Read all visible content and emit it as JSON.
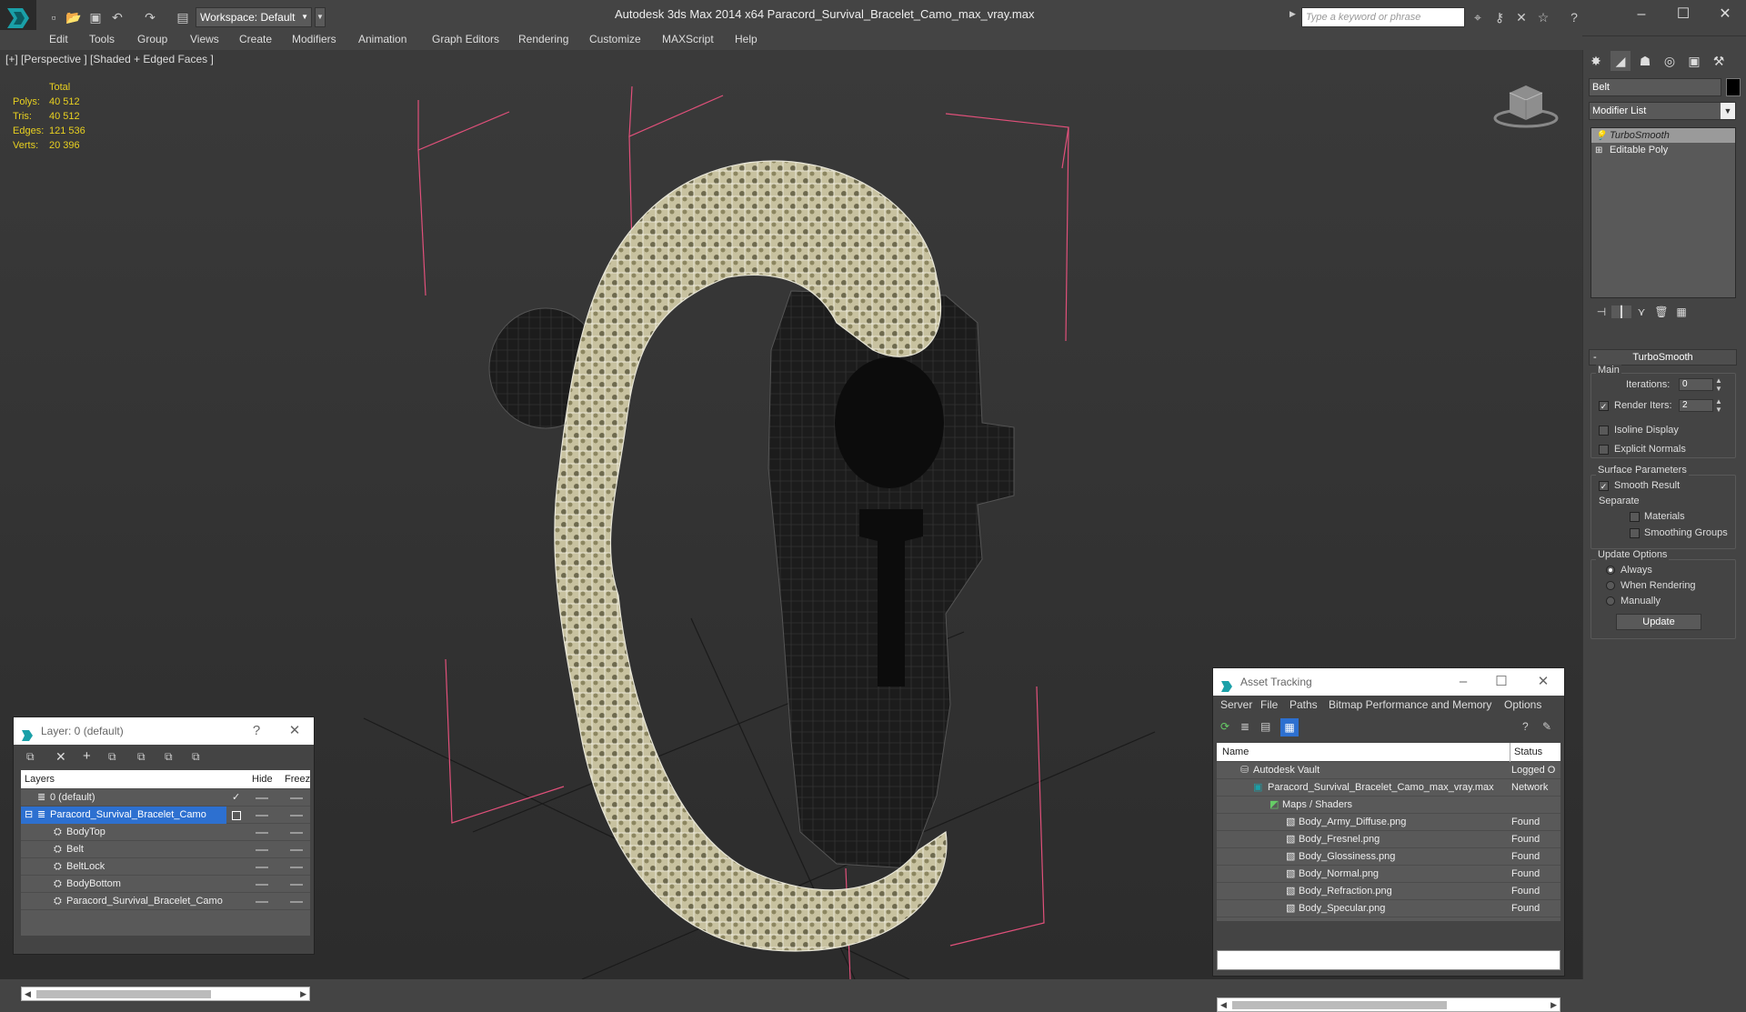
{
  "title_bar": {
    "app_title": "Autodesk 3ds Max  2014 x64      Paracord_Survival_Bracelet_Camo_max_vray.max",
    "workspace_label": "Workspace: Default",
    "search_placeholder": "Type a keyword or phrase"
  },
  "menu": [
    "Edit",
    "Tools",
    "Group",
    "Views",
    "Create",
    "Modifiers",
    "Animation",
    "Graph Editors",
    "Rendering",
    "Customize",
    "MAXScript",
    "Help"
  ],
  "viewport": {
    "label": "[+] [Perspective ] [Shaded + Edged Faces ]",
    "stats": {
      "header": "Total",
      "rows": [
        {
          "label": "Polys:",
          "value": "40 512"
        },
        {
          "label": "Tris:",
          "value": "40 512"
        },
        {
          "label": "Edges:",
          "value": "121 536"
        },
        {
          "label": "Verts:",
          "value": "20 396"
        }
      ]
    }
  },
  "command_panel": {
    "object_name": "Belt",
    "modifier_list": "Modifier List",
    "stack": [
      "TurboSmooth",
      "Editable Poly"
    ],
    "rollout_title": "TurboSmooth",
    "main_label": "Main",
    "iterations_label": "Iterations:",
    "iterations_value": "0",
    "render_iters_label": "Render Iters:",
    "render_iters_value": "2",
    "isoline_label": "Isoline Display",
    "explicit_normals_label": "Explicit Normals",
    "surface_params_label": "Surface Parameters",
    "smooth_result_label": "Smooth Result",
    "separate_label": "Separate",
    "materials_label": "Materials",
    "smoothing_groups_label": "Smoothing Groups",
    "update_options_label": "Update Options",
    "always_label": "Always",
    "when_rendering_label": "When Rendering",
    "manually_label": "Manually",
    "update_button": "Update"
  },
  "layer_panel": {
    "title": "Layer: 0 (default)",
    "help": "?",
    "columns": [
      "Layers",
      "Hide",
      "Freez"
    ],
    "rows": [
      {
        "name": "0 (default)",
        "level": 0
      },
      {
        "name": "Paracord_Survival_Bracelet_Camo",
        "level": 0
      },
      {
        "name": "BodyTop",
        "level": 1
      },
      {
        "name": "Belt",
        "level": 1
      },
      {
        "name": "BeltLock",
        "level": 1
      },
      {
        "name": "BodyBottom",
        "level": 1
      },
      {
        "name": "Paracord_Survival_Bracelet_Camo",
        "level": 1
      }
    ]
  },
  "asset_panel": {
    "title": "Asset Tracking",
    "menu": [
      "Server",
      "File",
      "Paths",
      "Bitmap Performance and Memory",
      "Options"
    ],
    "columns": [
      "Name",
      "Status"
    ],
    "rows": [
      {
        "name": "Autodesk Vault",
        "status": "Logged O",
        "level": 0
      },
      {
        "name": "Paracord_Survival_Bracelet_Camo_max_vray.max",
        "status": "Network",
        "level": 1
      },
      {
        "name": "Maps / Shaders",
        "status": "",
        "level": 2
      },
      {
        "name": "Body_Army_Diffuse.png",
        "status": "Found",
        "level": 3
      },
      {
        "name": "Body_Fresnel.png",
        "status": "Found",
        "level": 3
      },
      {
        "name": "Body_Glossiness.png",
        "status": "Found",
        "level": 3
      },
      {
        "name": "Body_Normal.png",
        "status": "Found",
        "level": 3
      },
      {
        "name": "Body_Refraction.png",
        "status": "Found",
        "level": 3
      },
      {
        "name": "Body_Specular.png",
        "status": "Found",
        "level": 3
      }
    ]
  },
  "colors": {
    "stats": "#e8d020",
    "selection": "#2d70d0",
    "grid_box": "#e0507a"
  }
}
